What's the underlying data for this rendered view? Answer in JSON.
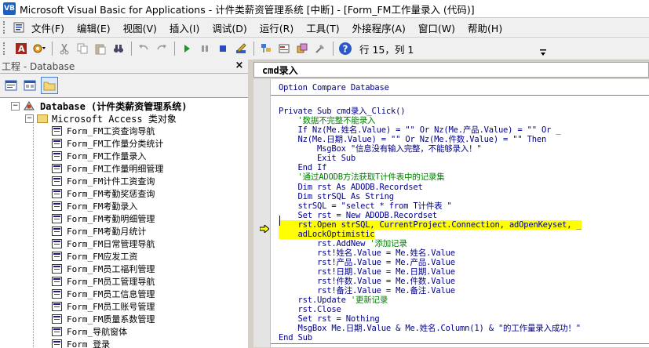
{
  "window": {
    "title": "Microsoft Visual Basic for Applications - 计件类薪资管理系统 [中断] - [Form_FM工作量录入 (代码)]"
  },
  "menu": [
    {
      "label": "文件(F)"
    },
    {
      "label": "编辑(E)"
    },
    {
      "label": "视图(V)"
    },
    {
      "label": "插入(I)"
    },
    {
      "label": "调试(D)"
    },
    {
      "label": "运行(R)"
    },
    {
      "label": "工具(T)"
    },
    {
      "label": "外接程序(A)"
    },
    {
      "label": "窗口(W)"
    },
    {
      "label": "帮助(H)"
    }
  ],
  "toolbar": {
    "position": "行 15，列 1"
  },
  "project": {
    "title": "工程 - Database",
    "root": "Database (计件类薪资管理系统)",
    "folder": "Microsoft Access 类对象",
    "items": [
      "Form_FM工资查询导航",
      "Form_FM工作量分类统计",
      "Form_FM工作量录入",
      "Form_FM工作量明细管理",
      "Form_FM计件工资查询",
      "Form_FM考勤奖惩查询",
      "Form_FM考勤录入",
      "Form_FM考勤明细管理",
      "Form_FM考勤月统计",
      "Form_FM日常管理导航",
      "Form_FM应发工资",
      "Form_FM员工福利管理",
      "Form_FM员工管理导航",
      "Form_FM员工信息管理",
      "Form_FM员工账号管理",
      "Form_FM质量系数管理",
      "Form_导航窗体",
      "Form_登录"
    ]
  },
  "code": {
    "procedure_combo": "cmd录入",
    "lines": [
      {
        "text": "Option Compare Database",
        "style": "plain"
      },
      {
        "text": "",
        "style": "plain"
      },
      {
        "text": "Private Sub cmd录入_Click()",
        "style": "plain"
      },
      {
        "text": "    '数据不完整不能录入",
        "style": "comment"
      },
      {
        "text": "    If Nz(Me.姓名.Value) = \"\" Or Nz(Me.产品.Value) = \"\" Or _",
        "style": "plain"
      },
      {
        "text": "    Nz(Me.日期.Value) = \"\" Or Nz(Me.件数.Value) = \"\" Then",
        "style": "plain"
      },
      {
        "text": "        MsgBox \"信息没有输入完整，不能够录入！\"",
        "style": "plain"
      },
      {
        "text": "        Exit Sub",
        "style": "plain"
      },
      {
        "text": "    End If",
        "style": "plain"
      },
      {
        "text": "    '通过ADODB方法获取T计件表中的记录集",
        "style": "comment"
      },
      {
        "text": "    Dim rst As ADODB.Recordset",
        "style": "plain"
      },
      {
        "text": "    Dim strSQL As String",
        "style": "plain"
      },
      {
        "text": "    strSQL = \"select * from T计件表 \"",
        "style": "plain"
      },
      {
        "text": "    Set rst = New ADODB.Recordset",
        "style": "plain"
      },
      {
        "text": "    rst.Open strSQL, CurrentProject.Connection, adOpenKeyset, _",
        "style": "highlight"
      },
      {
        "text": "    adLockOptimistic",
        "style": "highlight"
      },
      {
        "text": "        rst.AddNew '添加记录",
        "style": "mixed",
        "code": "        rst.AddNew ",
        "comment": "'添加记录"
      },
      {
        "text": "        rst!姓名.Value = Me.姓名.Value",
        "style": "plain"
      },
      {
        "text": "        rst!产品.Value = Me.产品.Value",
        "style": "plain"
      },
      {
        "text": "        rst!日期.Value = Me.日期.Value",
        "style": "plain"
      },
      {
        "text": "        rst!件数.Value = Me.件数.Value",
        "style": "plain"
      },
      {
        "text": "        rst!备注.Value = Me.备注.Value",
        "style": "plain"
      },
      {
        "text": "    rst.Update '更新记录",
        "style": "mixed",
        "code": "    rst.Update ",
        "comment": "'更新记录"
      },
      {
        "text": "    rst.Close",
        "style": "plain"
      },
      {
        "text": "    Set rst = Nothing",
        "style": "plain"
      },
      {
        "text": "    MsgBox Me.日期.Value & Me.姓名.Column(1) & \"的工作量录入成功！\"",
        "style": "plain"
      },
      {
        "text": "End Sub",
        "style": "plain"
      }
    ]
  },
  "colors": {
    "keyword": "#00008b",
    "comment": "#008000",
    "highlight": "#ffff00"
  }
}
